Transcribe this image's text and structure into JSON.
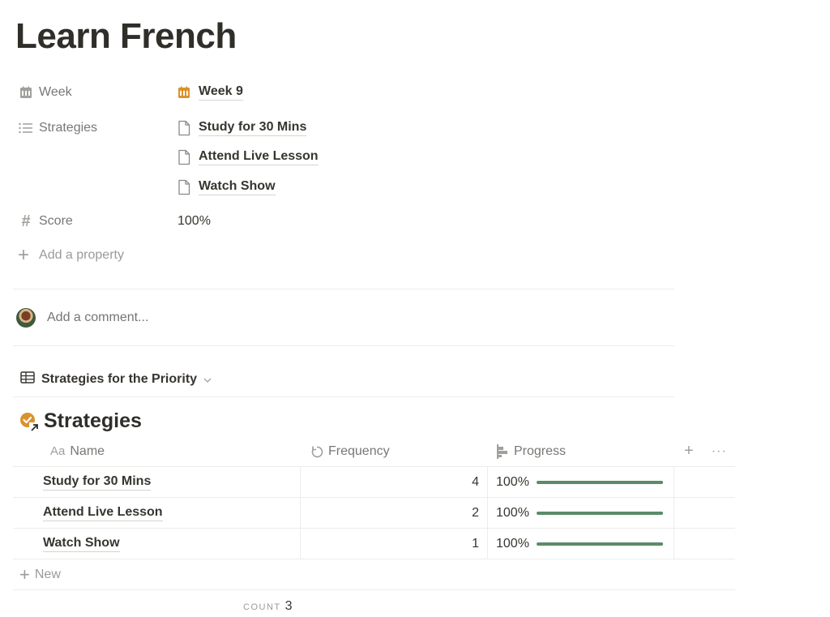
{
  "page": {
    "title": "Learn French"
  },
  "properties": {
    "week": {
      "label": "Week",
      "icon": "calendar-icon",
      "value": "Week 9",
      "value_icon": "calendar-icon",
      "value_icon_color": "#d9922e"
    },
    "strategies": {
      "label": "Strategies",
      "icon": "list-icon",
      "values": [
        "Study for 30 Mins",
        "Attend Live Lesson",
        "Watch Show"
      ],
      "value_icon": "page-icon"
    },
    "score": {
      "label": "Score",
      "icon": "hash-icon",
      "value": "100%"
    },
    "add_property": {
      "label": "Add a property",
      "icon": "plus-icon"
    }
  },
  "comment": {
    "placeholder": "Add a comment..."
  },
  "view": {
    "label": "Strategies for the Priority",
    "icon": "table-icon",
    "chevron": "chevron-down-icon"
  },
  "database": {
    "title": "Strategies",
    "icon": "check-circle-link-icon",
    "icon_color": "#d9922e",
    "columns": [
      {
        "label": "Name",
        "icon": "text-aa-icon"
      },
      {
        "label": "Frequency",
        "icon": "rollup-icon"
      },
      {
        "label": "Progress",
        "icon": "progress-icon"
      }
    ],
    "rows": [
      {
        "name": "Study for 30 Mins",
        "frequency": "4",
        "progress_label": "100%",
        "progress": 1.0
      },
      {
        "name": "Attend Live Lesson",
        "frequency": "2",
        "progress_label": "100%",
        "progress": 1.0
      },
      {
        "name": "Watch Show",
        "frequency": "1",
        "progress_label": "100%",
        "progress": 1.0
      }
    ],
    "new_label": "New",
    "count_label": "COUNT",
    "count_value": "3",
    "progress_color": "#5b8b69"
  }
}
